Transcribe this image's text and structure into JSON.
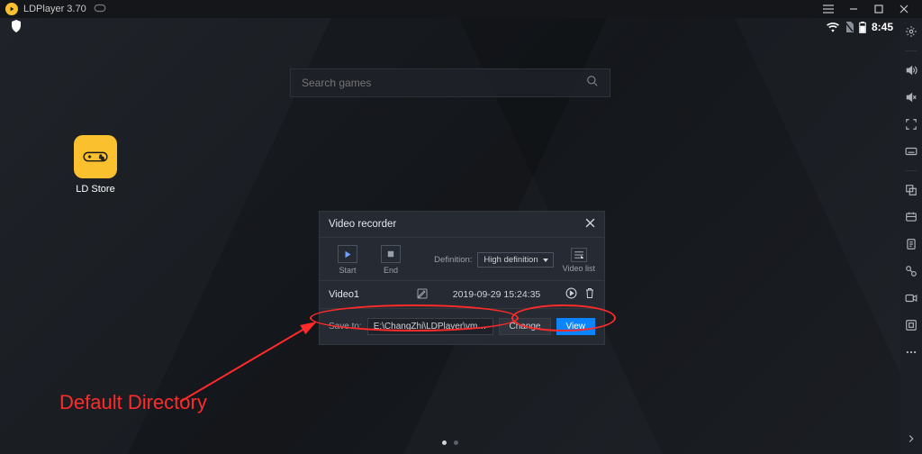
{
  "titlebar": {
    "title": "LDPlayer 3.70"
  },
  "statusbar": {
    "time": "8:45",
    "battery_level": 3
  },
  "search": {
    "placeholder": "Search games"
  },
  "desktop": {
    "apps": [
      {
        "label": "LD Store"
      }
    ]
  },
  "pager": {
    "count": 2,
    "active": 0
  },
  "dialog": {
    "title": "Video recorder",
    "start_label": "Start",
    "end_label": "End",
    "definition_label": "Definition:",
    "definition_value": "High definition",
    "video_list_label": "Video list",
    "videos": [
      {
        "name": "Video1",
        "timestamp": "2019-09-29 15:24:35"
      }
    ],
    "save_to_label": "Save to:",
    "save_path": "E:\\ChangZhi\\LDPlayer\\vms\\video\\",
    "change_label": "Change",
    "view_label": "View"
  },
  "annotation": {
    "text": "Default Directory"
  }
}
